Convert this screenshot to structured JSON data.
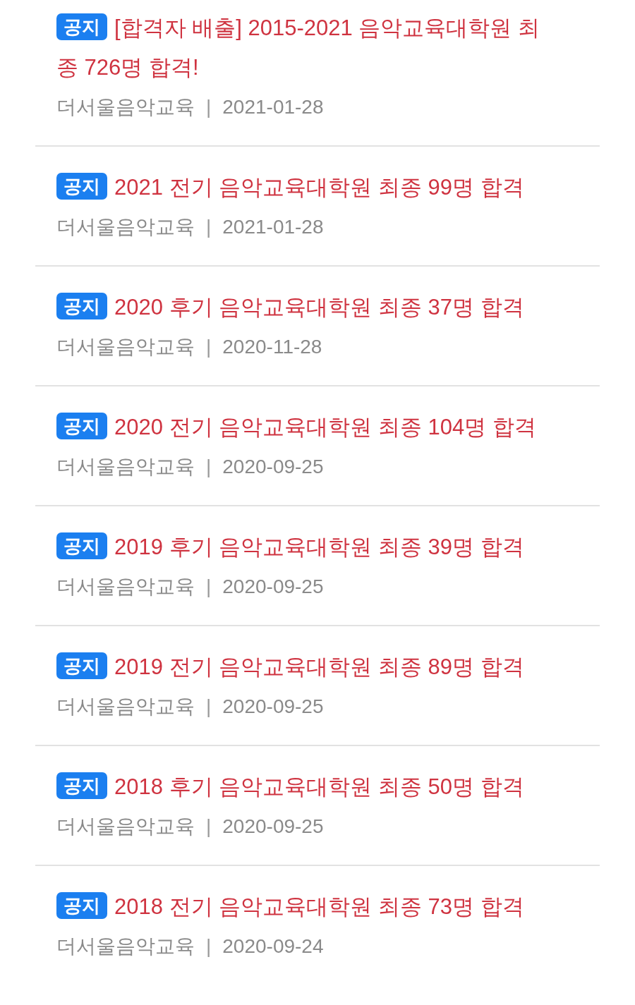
{
  "notices": [
    {
      "badge": "공지",
      "title": "[합격자 배출] 2015-2021 음악교육대학원 최종 726명 합격!",
      "author": "더서울음악교육",
      "separator": "|",
      "date": "2021-01-28"
    },
    {
      "badge": "공지",
      "title": "2021 전기 음악교육대학원 최종 99명 합격",
      "author": "더서울음악교육",
      "separator": "|",
      "date": "2021-01-28"
    },
    {
      "badge": "공지",
      "title": "2020 후기 음악교육대학원 최종 37명 합격",
      "author": "더서울음악교육",
      "separator": "|",
      "date": "2020-11-28"
    },
    {
      "badge": "공지",
      "title": "2020 전기 음악교육대학원 최종 104명 합격",
      "author": "더서울음악교육",
      "separator": "|",
      "date": "2020-09-25"
    },
    {
      "badge": "공지",
      "title": "2019 후기 음악교육대학원 최종 39명 합격",
      "author": "더서울음악교육",
      "separator": "|",
      "date": "2020-09-25"
    },
    {
      "badge": "공지",
      "title": "2019 전기 음악교육대학원 최종 89명 합격",
      "author": "더서울음악교육",
      "separator": "|",
      "date": "2020-09-25"
    },
    {
      "badge": "공지",
      "title": "2018 후기 음악교육대학원 최종 50명 합격",
      "author": "더서울음악교육",
      "separator": "|",
      "date": "2020-09-25"
    },
    {
      "badge": "공지",
      "title": "2018 전기 음악교육대학원 최종 73명 합격",
      "author": "더서울음악교육",
      "separator": "|",
      "date": "2020-09-24"
    }
  ]
}
